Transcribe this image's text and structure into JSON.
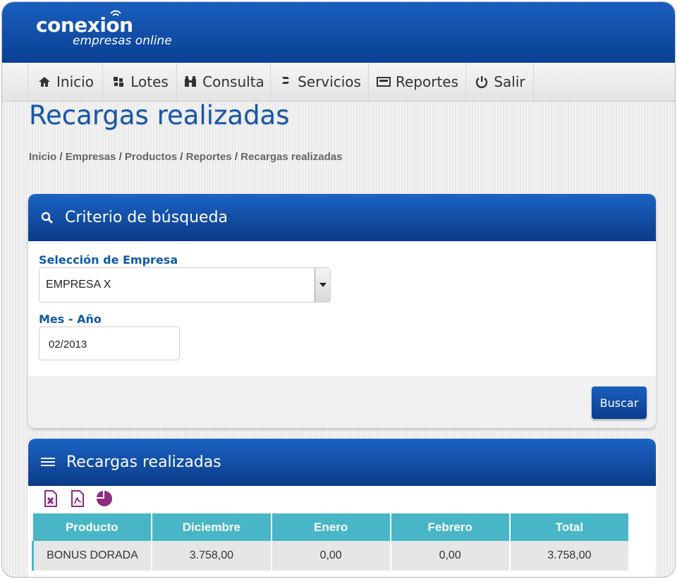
{
  "brand": {
    "name": "conexion",
    "tagline": "empresas online"
  },
  "nav": [
    {
      "label": "Inicio",
      "icon": "home-icon"
    },
    {
      "label": "Lotes",
      "icon": "lotes-icon"
    },
    {
      "label": "Consulta",
      "icon": "binoculars-icon"
    },
    {
      "label": "Servicios",
      "icon": "services-icon"
    },
    {
      "label": "Reportes",
      "icon": "reports-icon"
    },
    {
      "label": "Salir",
      "icon": "power-icon"
    }
  ],
  "page_title": "Recargas realizadas",
  "breadcrumb": [
    "Inicio",
    "Empresas",
    "Productos",
    "Reportes",
    "Recargas realizadas"
  ],
  "search_panel": {
    "title": "Criterio de búsqueda",
    "company_label": "Selección de Empresa",
    "company_value": "EMPRESA X",
    "date_label": "Mes - Año",
    "date_value": "02/2013",
    "search_button": "Buscar"
  },
  "results_panel": {
    "title": "Recargas realizadas",
    "tools": [
      "excel-icon",
      "pdf-icon",
      "pie-chart-icon"
    ],
    "columns": [
      "Producto",
      "Diciembre",
      "Enero",
      "Febrero",
      "Total"
    ],
    "rows": [
      [
        "BONUS DORADA",
        "3.758,00",
        "0,00",
        "0,00",
        "3.758,00"
      ]
    ]
  },
  "colors": {
    "header_blue": "#0a3f93",
    "accent_teal": "#48b6c6",
    "title_blue": "#1657a8"
  }
}
